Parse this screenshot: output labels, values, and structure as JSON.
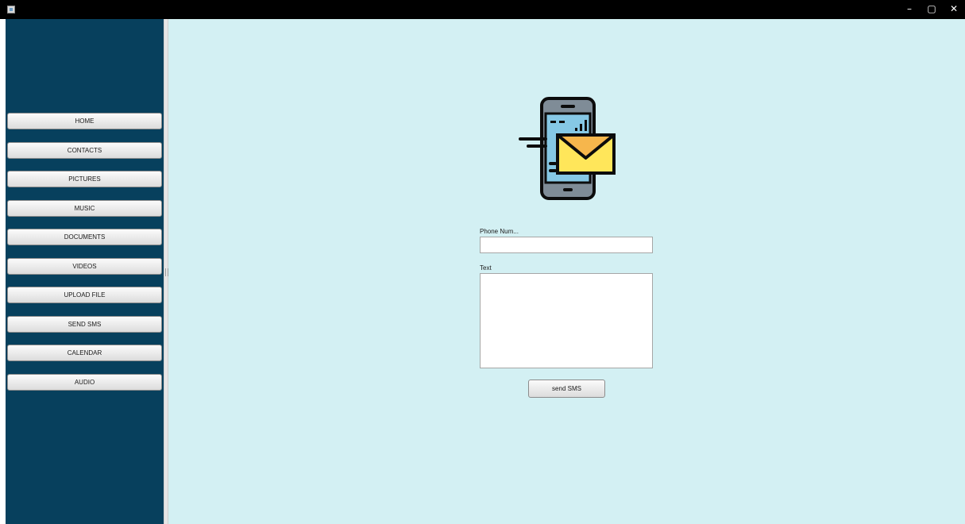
{
  "window": {
    "controls": {
      "minimize": "–",
      "maximize": "▢",
      "close": "✕"
    }
  },
  "sidebar": {
    "items": [
      {
        "label": "HOME"
      },
      {
        "label": "CONTACTS"
      },
      {
        "label": "PICTURES"
      },
      {
        "label": "MUSIC"
      },
      {
        "label": "DOCUMENTS"
      },
      {
        "label": "VIDEOS"
      },
      {
        "label": "UPLOAD FILE"
      },
      {
        "label": "SEND SMS"
      },
      {
        "label": "CALENDAR"
      },
      {
        "label": "AUDIO"
      }
    ]
  },
  "form": {
    "icon": "sms-phone-envelope-icon",
    "phone_label": "Phone Num...",
    "phone_value": "",
    "text_label": "Text",
    "text_value": "",
    "send_label": "send SMS"
  },
  "colors": {
    "sidebar": "#07405d",
    "content": "#d3f0f3",
    "titlebar": "#000000",
    "phone_body": "#7f8c97",
    "phone_screen": "#86c8e5",
    "envelope": "#ffe65a"
  }
}
